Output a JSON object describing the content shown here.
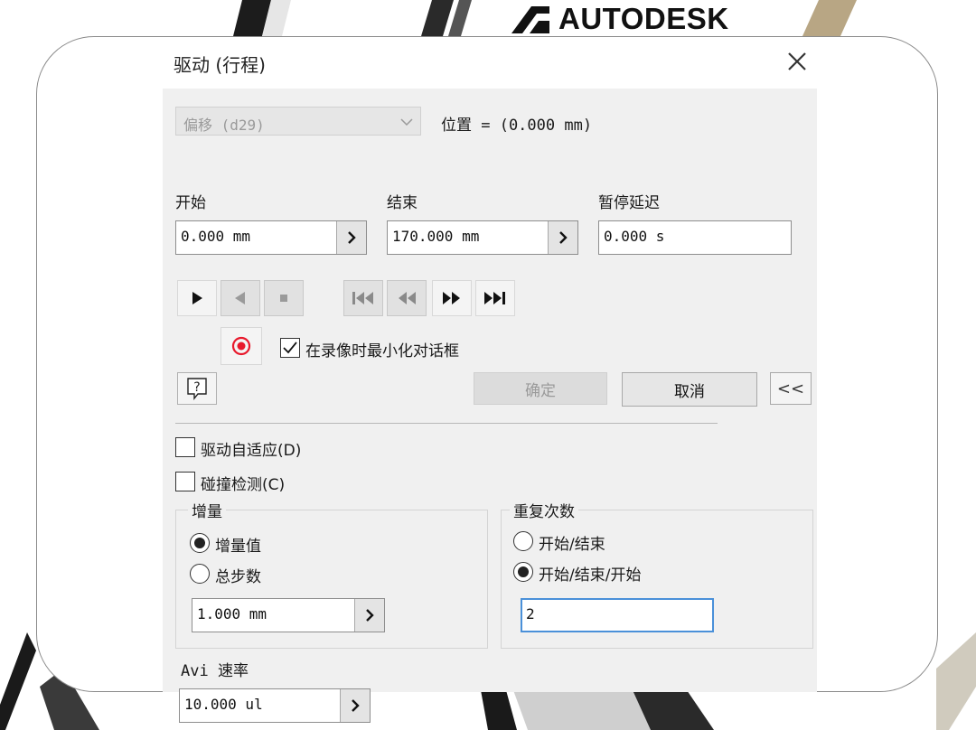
{
  "brand": {
    "name": "AUTODESK"
  },
  "dialog": {
    "title": "驱动 (行程)",
    "close_icon": "close-icon",
    "parameter": {
      "selected": "偏移 (d29)",
      "position_readout": "位置 = (0.000 mm)"
    },
    "start": {
      "label": "开始",
      "value": "0.000 mm"
    },
    "end": {
      "label": "结束",
      "value": "170.000 mm"
    },
    "pause": {
      "label": "暂停延迟",
      "value": "0.000 s"
    },
    "transport": {
      "play_forward_icon": "play-forward-icon",
      "play_reverse_icon": "play-reverse-icon",
      "stop_icon": "stop-icon",
      "go_to_start_icon": "go-to-start-icon",
      "step_back_icon": "step-back-icon",
      "step_forward_icon": "step-forward-icon",
      "go_to_end_icon": "go-to-end-icon"
    },
    "record": {
      "icon": "record-icon",
      "color": "#e8192c",
      "minimize_label": "在录像时最小化对话框",
      "minimize_checked": true
    },
    "buttons": {
      "help_icon": "help-icon",
      "ok": "确定",
      "cancel": "取消",
      "collapse": "<<"
    },
    "options": {
      "adaptive": {
        "label": "驱动自适应(D)",
        "checked": false
      },
      "collision": {
        "label": "碰撞检测(C)",
        "checked": false
      }
    },
    "increment": {
      "group_label": "增量",
      "options": [
        "增量值",
        "总步数"
      ],
      "selected": "增量值",
      "value": "1.000 mm"
    },
    "repetitions": {
      "group_label": "重复次数",
      "options": [
        "开始/结束",
        "开始/结束/开始"
      ],
      "selected": "开始/结束/开始",
      "value": "2",
      "focus_color": "#4a90d9"
    },
    "avi": {
      "label": "Avi 速率",
      "value": "10.000 ul"
    }
  }
}
